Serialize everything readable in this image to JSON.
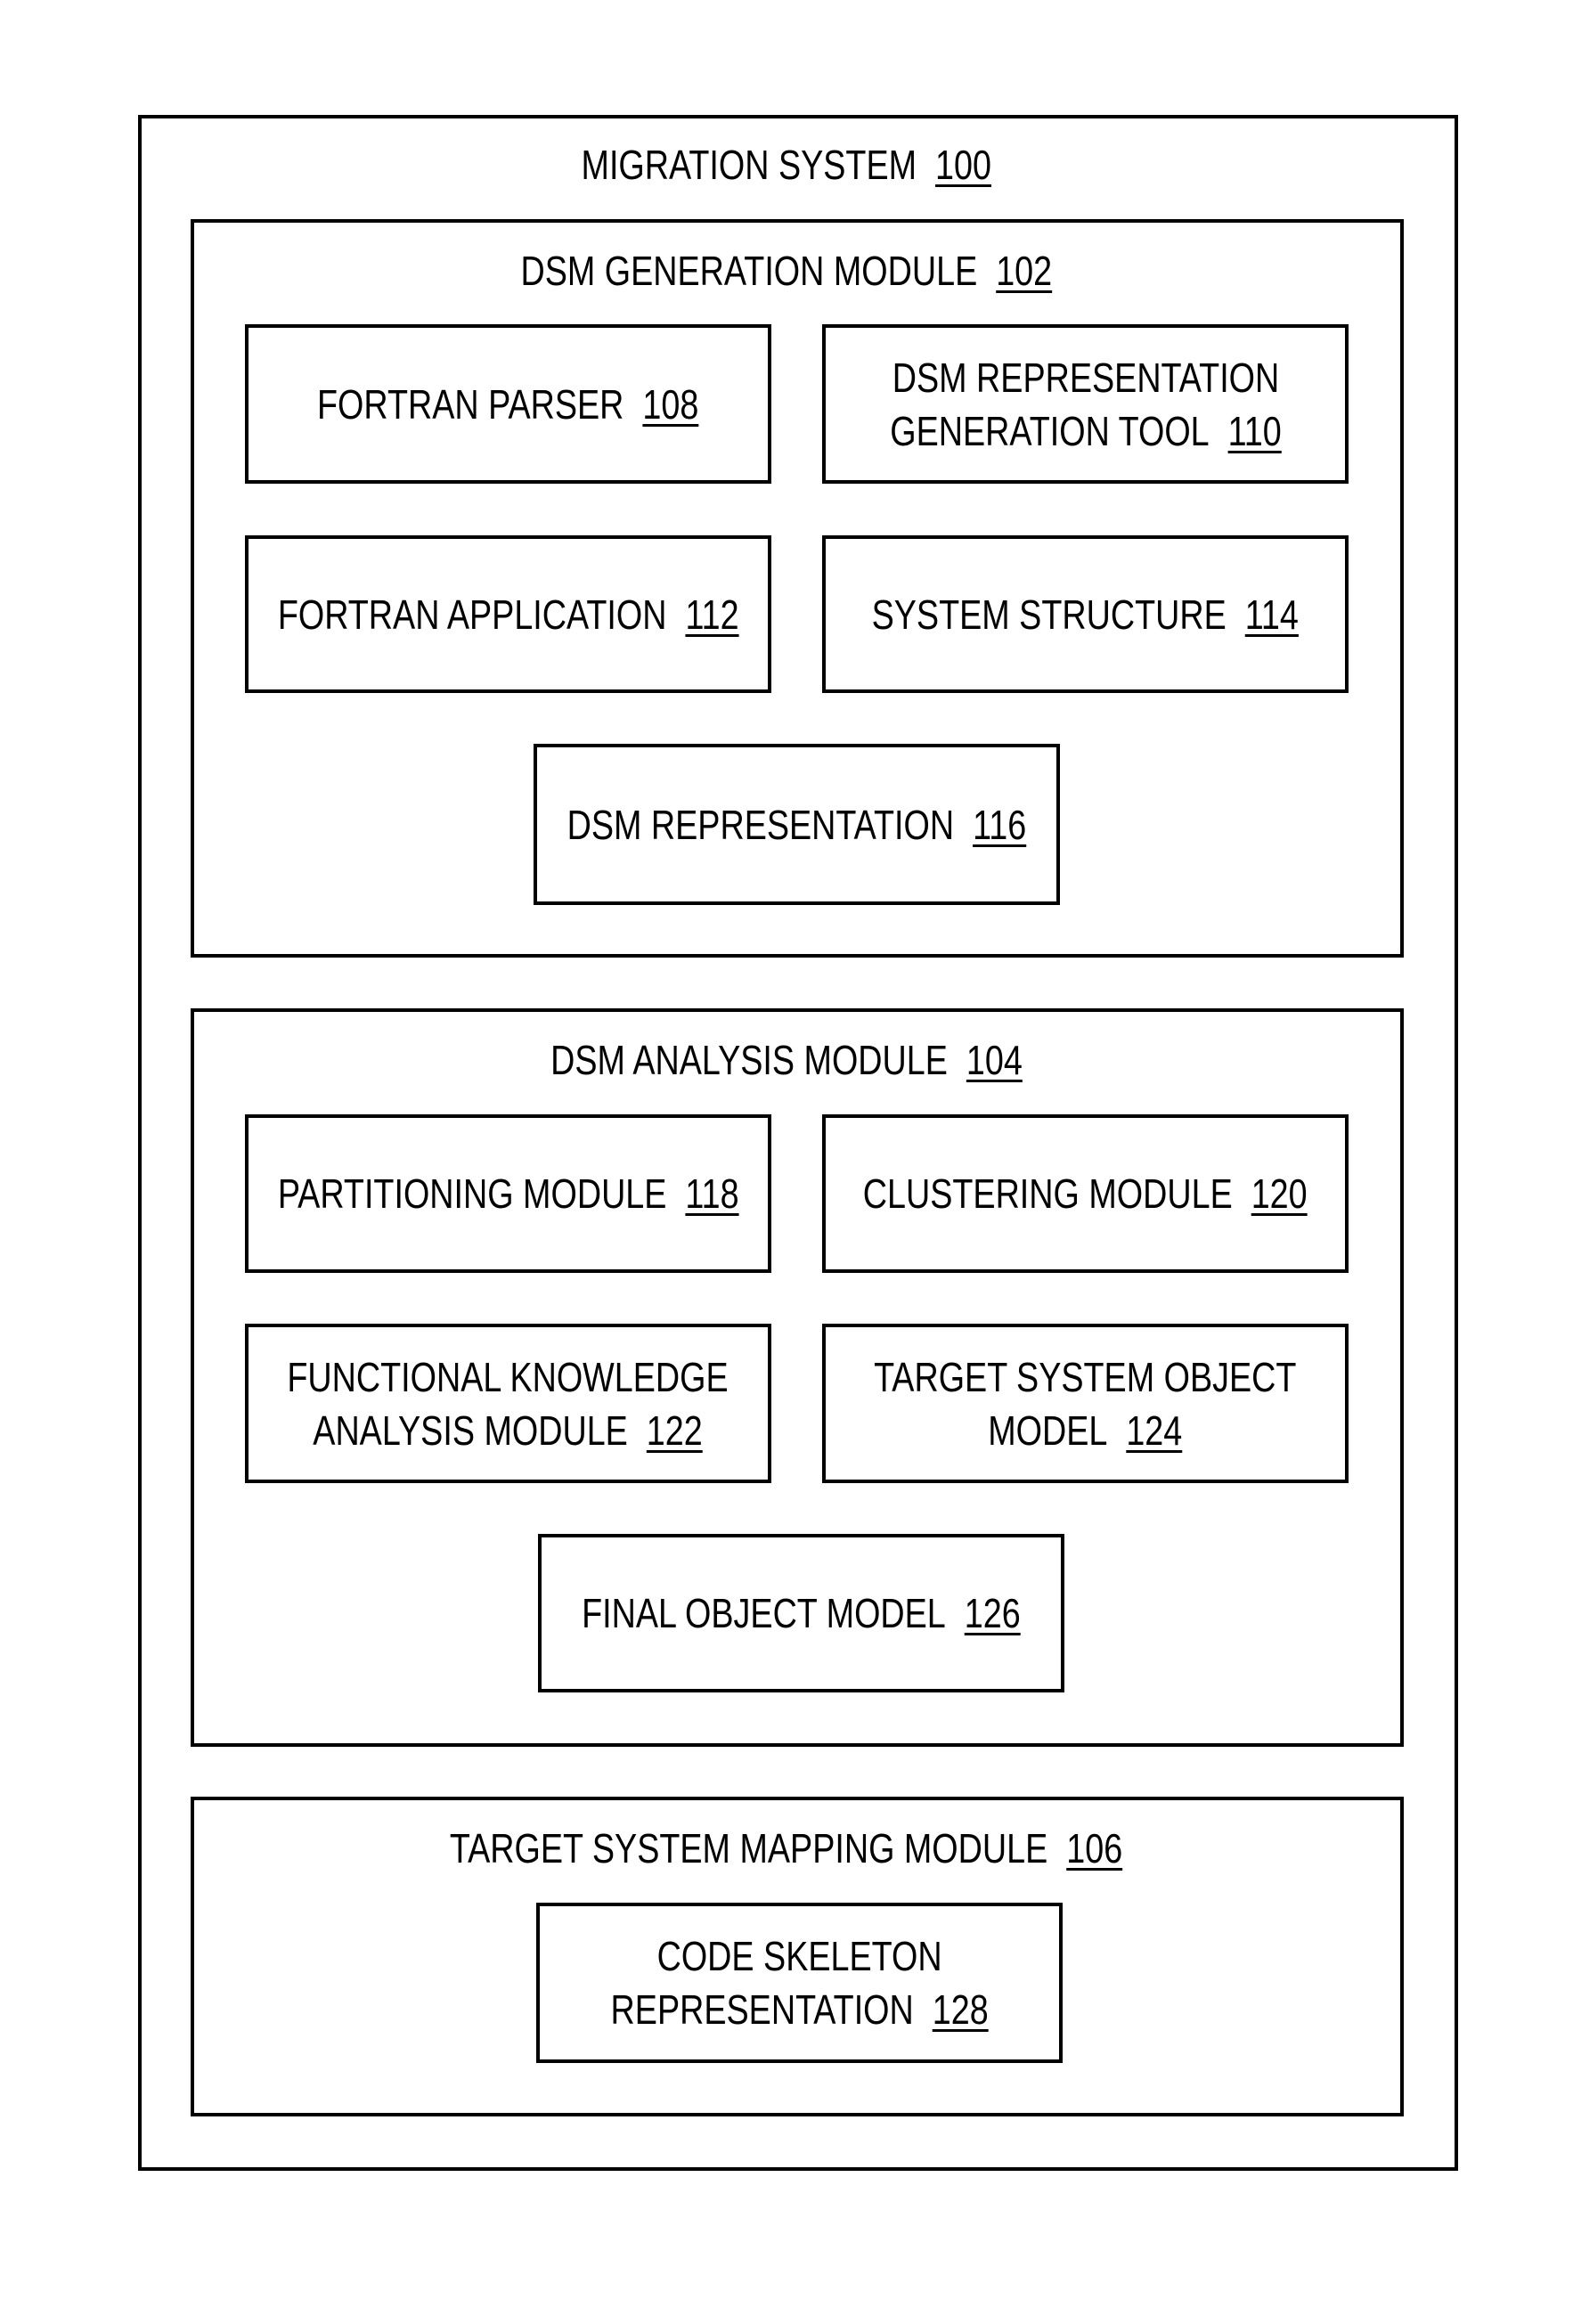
{
  "diagram": {
    "outer": {
      "title": "MIGRATION SYSTEM",
      "ref": "100"
    },
    "modules": [
      {
        "title": "DSM GENERATION MODULE",
        "ref": "102",
        "components": [
          {
            "lines": [
              "FORTRAN PARSER"
            ],
            "ref": "108"
          },
          {
            "lines": [
              "DSM REPRESENTATION",
              "GENERATION TOOL"
            ],
            "ref": "110"
          },
          {
            "lines": [
              "FORTRAN APPLICATION"
            ],
            "ref": "112"
          },
          {
            "lines": [
              "SYSTEM STRUCTURE"
            ],
            "ref": "114"
          },
          {
            "lines": [
              "DSM REPRESENTATION"
            ],
            "ref": "116"
          }
        ]
      },
      {
        "title": "DSM ANALYSIS MODULE",
        "ref": "104",
        "components": [
          {
            "lines": [
              "PARTITIONING MODULE"
            ],
            "ref": "118"
          },
          {
            "lines": [
              "CLUSTERING MODULE"
            ],
            "ref": "120"
          },
          {
            "lines": [
              "FUNCTIONAL KNOWLEDGE",
              "ANALYSIS MODULE"
            ],
            "ref": "122"
          },
          {
            "lines": [
              "TARGET SYSTEM OBJECT",
              "MODEL"
            ],
            "ref": "124"
          },
          {
            "lines": [
              "FINAL OBJECT MODEL"
            ],
            "ref": "126"
          }
        ]
      },
      {
        "title": "TARGET SYSTEM MAPPING MODULE",
        "ref": "106",
        "components": [
          {
            "lines": [
              "CODE SKELETON",
              "REPRESENTATION"
            ],
            "ref": "128"
          }
        ]
      }
    ]
  }
}
